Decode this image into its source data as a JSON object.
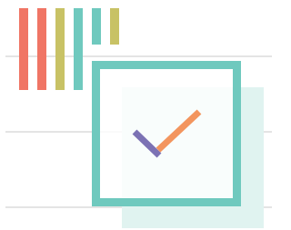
{
  "illustration": {
    "icon": "checked-box-icon",
    "colors": {
      "bar_red": "#f07565",
      "bar_olive": "#c8c265",
      "bar_teal": "#6fc9be",
      "frame": "#6fc9be",
      "shadow": "#e0f3f0",
      "check_short": "#7c72b4",
      "check_long": "#f3955e",
      "rule": "#d3d3d3"
    }
  }
}
